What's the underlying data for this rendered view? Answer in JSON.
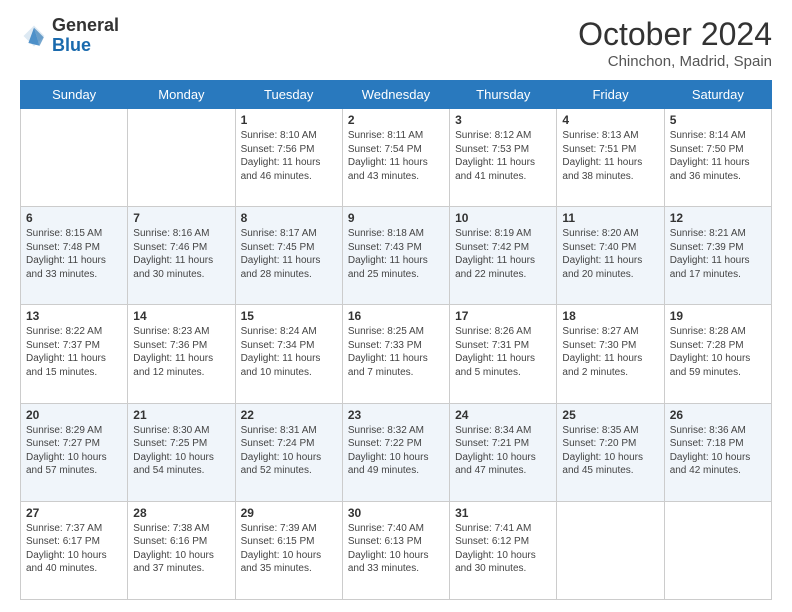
{
  "logo": {
    "general": "General",
    "blue": "Blue"
  },
  "header": {
    "month": "October 2024",
    "location": "Chinchon, Madrid, Spain"
  },
  "weekdays": [
    "Sunday",
    "Monday",
    "Tuesday",
    "Wednesday",
    "Thursday",
    "Friday",
    "Saturday"
  ],
  "weeks": [
    [
      {
        "day": "",
        "content": ""
      },
      {
        "day": "",
        "content": ""
      },
      {
        "day": "1",
        "content": "Sunrise: 8:10 AM\nSunset: 7:56 PM\nDaylight: 11 hours and 46 minutes."
      },
      {
        "day": "2",
        "content": "Sunrise: 8:11 AM\nSunset: 7:54 PM\nDaylight: 11 hours and 43 minutes."
      },
      {
        "day": "3",
        "content": "Sunrise: 8:12 AM\nSunset: 7:53 PM\nDaylight: 11 hours and 41 minutes."
      },
      {
        "day": "4",
        "content": "Sunrise: 8:13 AM\nSunset: 7:51 PM\nDaylight: 11 hours and 38 minutes."
      },
      {
        "day": "5",
        "content": "Sunrise: 8:14 AM\nSunset: 7:50 PM\nDaylight: 11 hours and 36 minutes."
      }
    ],
    [
      {
        "day": "6",
        "content": "Sunrise: 8:15 AM\nSunset: 7:48 PM\nDaylight: 11 hours and 33 minutes."
      },
      {
        "day": "7",
        "content": "Sunrise: 8:16 AM\nSunset: 7:46 PM\nDaylight: 11 hours and 30 minutes."
      },
      {
        "day": "8",
        "content": "Sunrise: 8:17 AM\nSunset: 7:45 PM\nDaylight: 11 hours and 28 minutes."
      },
      {
        "day": "9",
        "content": "Sunrise: 8:18 AM\nSunset: 7:43 PM\nDaylight: 11 hours and 25 minutes."
      },
      {
        "day": "10",
        "content": "Sunrise: 8:19 AM\nSunset: 7:42 PM\nDaylight: 11 hours and 22 minutes."
      },
      {
        "day": "11",
        "content": "Sunrise: 8:20 AM\nSunset: 7:40 PM\nDaylight: 11 hours and 20 minutes."
      },
      {
        "day": "12",
        "content": "Sunrise: 8:21 AM\nSunset: 7:39 PM\nDaylight: 11 hours and 17 minutes."
      }
    ],
    [
      {
        "day": "13",
        "content": "Sunrise: 8:22 AM\nSunset: 7:37 PM\nDaylight: 11 hours and 15 minutes."
      },
      {
        "day": "14",
        "content": "Sunrise: 8:23 AM\nSunset: 7:36 PM\nDaylight: 11 hours and 12 minutes."
      },
      {
        "day": "15",
        "content": "Sunrise: 8:24 AM\nSunset: 7:34 PM\nDaylight: 11 hours and 10 minutes."
      },
      {
        "day": "16",
        "content": "Sunrise: 8:25 AM\nSunset: 7:33 PM\nDaylight: 11 hours and 7 minutes."
      },
      {
        "day": "17",
        "content": "Sunrise: 8:26 AM\nSunset: 7:31 PM\nDaylight: 11 hours and 5 minutes."
      },
      {
        "day": "18",
        "content": "Sunrise: 8:27 AM\nSunset: 7:30 PM\nDaylight: 11 hours and 2 minutes."
      },
      {
        "day": "19",
        "content": "Sunrise: 8:28 AM\nSunset: 7:28 PM\nDaylight: 10 hours and 59 minutes."
      }
    ],
    [
      {
        "day": "20",
        "content": "Sunrise: 8:29 AM\nSunset: 7:27 PM\nDaylight: 10 hours and 57 minutes."
      },
      {
        "day": "21",
        "content": "Sunrise: 8:30 AM\nSunset: 7:25 PM\nDaylight: 10 hours and 54 minutes."
      },
      {
        "day": "22",
        "content": "Sunrise: 8:31 AM\nSunset: 7:24 PM\nDaylight: 10 hours and 52 minutes."
      },
      {
        "day": "23",
        "content": "Sunrise: 8:32 AM\nSunset: 7:22 PM\nDaylight: 10 hours and 49 minutes."
      },
      {
        "day": "24",
        "content": "Sunrise: 8:34 AM\nSunset: 7:21 PM\nDaylight: 10 hours and 47 minutes."
      },
      {
        "day": "25",
        "content": "Sunrise: 8:35 AM\nSunset: 7:20 PM\nDaylight: 10 hours and 45 minutes."
      },
      {
        "day": "26",
        "content": "Sunrise: 8:36 AM\nSunset: 7:18 PM\nDaylight: 10 hours and 42 minutes."
      }
    ],
    [
      {
        "day": "27",
        "content": "Sunrise: 7:37 AM\nSunset: 6:17 PM\nDaylight: 10 hours and 40 minutes."
      },
      {
        "day": "28",
        "content": "Sunrise: 7:38 AM\nSunset: 6:16 PM\nDaylight: 10 hours and 37 minutes."
      },
      {
        "day": "29",
        "content": "Sunrise: 7:39 AM\nSunset: 6:15 PM\nDaylight: 10 hours and 35 minutes."
      },
      {
        "day": "30",
        "content": "Sunrise: 7:40 AM\nSunset: 6:13 PM\nDaylight: 10 hours and 33 minutes."
      },
      {
        "day": "31",
        "content": "Sunrise: 7:41 AM\nSunset: 6:12 PM\nDaylight: 10 hours and 30 minutes."
      },
      {
        "day": "",
        "content": ""
      },
      {
        "day": "",
        "content": ""
      }
    ]
  ]
}
